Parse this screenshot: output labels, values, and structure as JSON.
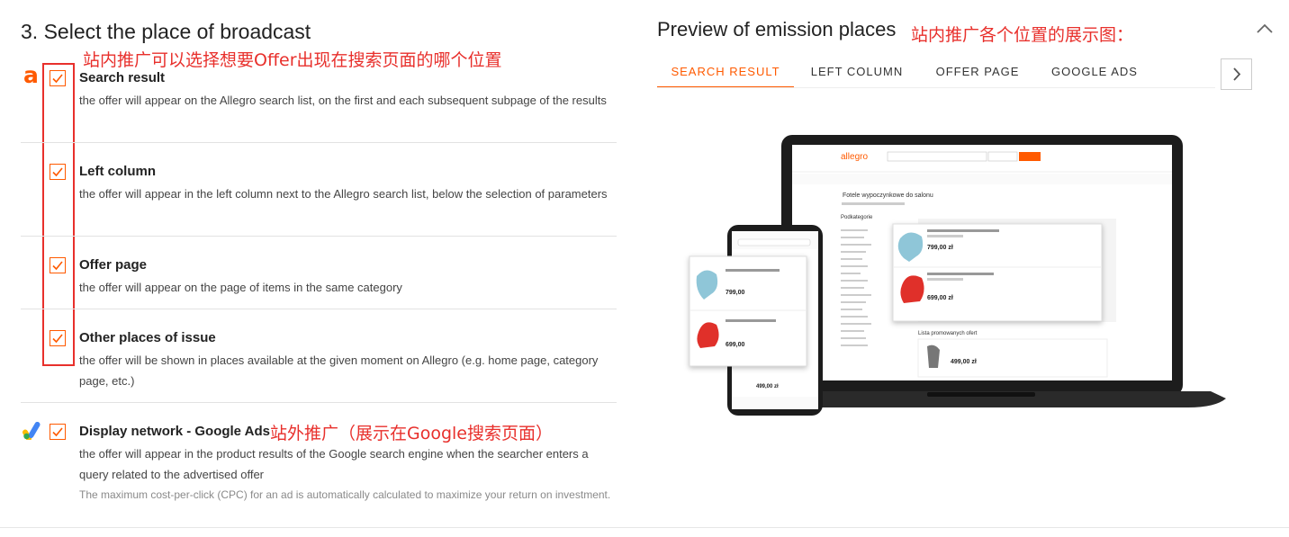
{
  "left": {
    "section_title": "3. Select the place of broadcast",
    "annotation_top": "站内推广可以选择想要Offer出现在搜索页面的哪个位置",
    "allegro_logo_letter": "a",
    "options": [
      {
        "title": "Search result",
        "desc": "the offer will appear on the Allegro search list, on the first and each subsequent subpage of the results",
        "checked": true
      },
      {
        "title": "Left column",
        "desc": "the offer will appear in the left column next to the Allegro search list, below the selection of parameters",
        "checked": true
      },
      {
        "title": "Offer page",
        "desc": "the offer will appear on the page of items in the same category",
        "checked": true
      },
      {
        "title": "Other places of issue",
        "desc": "the offer will be shown in places available at the given moment on Allegro (e.g. home page, category page, etc.)",
        "checked": true
      },
      {
        "title": "Display network - Google Ads",
        "desc": "the offer will appear in the product results of the Google search engine when the searcher enters a query related to the advertised offer",
        "note": "The maximum cost-per-click (CPC) for an ad is automatically calculated to maximize your return on investment.",
        "checked": true
      }
    ],
    "annotation_google": "站外推广（展示在Google搜索页面）"
  },
  "right": {
    "title": "Preview of emission places",
    "annotation": "站内推广各个位置的展示图：",
    "tabs": [
      "SEARCH RESULT",
      "LEFT COLUMN",
      "OFFER PAGE",
      "GOOGLE ADS"
    ],
    "active_tab": 0
  },
  "preview": {
    "laptop_brand": "allegro",
    "laptop_heading": "Fotele wypoczynkowe do salonu",
    "laptop_sidebar_title": "Podkategorie",
    "laptop_list_title": "Lista promowanych ofert",
    "laptop_price_1": "799,00 zł",
    "laptop_price_2": "699,00 zł",
    "laptop_price_3": "499,00 zł",
    "phone_price_1": "799,00",
    "phone_price_2": "699,00",
    "phone_price_3": "499,00 zł"
  },
  "colors": {
    "accent": "#ff5a00",
    "annotation": "#e8302c",
    "google_blue": "#4285f4",
    "google_yellow": "#fbbc04",
    "google_green": "#34a853"
  },
  "icons": [
    "allegro-logo",
    "checkbox-check-icon",
    "google-ads-icon",
    "chevron-up-icon",
    "chevron-right-icon"
  ]
}
